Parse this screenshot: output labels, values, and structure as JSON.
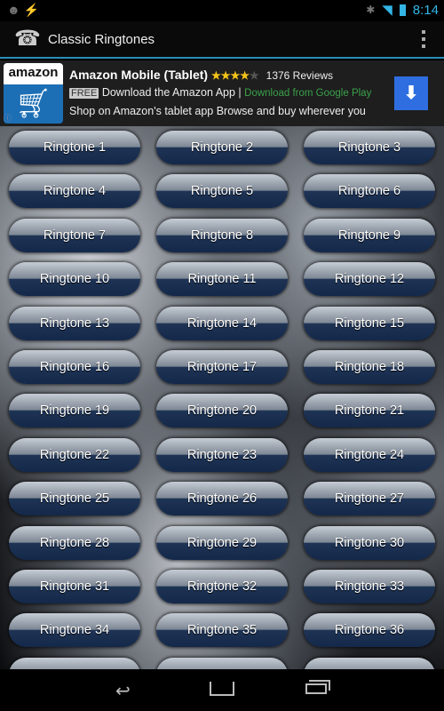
{
  "status_bar": {
    "time": "8:14",
    "icons": [
      "android-debug-icon",
      "usb-charge-icon",
      "bluetooth-icon",
      "wifi-icon",
      "battery-icon"
    ]
  },
  "action_bar": {
    "title": "Classic Ringtones",
    "icon": "vintage-telephone-icon",
    "menu": "overflow-menu-icon"
  },
  "ad": {
    "logo_text": "amazon",
    "title": "Amazon Mobile (Tablet)",
    "rating": 4,
    "rating_max": 5,
    "reviews": "1376 Reviews",
    "free_badge": "FREE",
    "line2": "Download the Amazon App |",
    "cta": "Download from Google Play",
    "line3": "Shop on Amazon's tablet app Browse and buy wherever you",
    "accent": "#2f6ee0"
  },
  "ringtones": [
    "Ringtone 1",
    "Ringtone 2",
    "Ringtone 3",
    "Ringtone 4",
    "Ringtone 5",
    "Ringtone 6",
    "Ringtone 7",
    "Ringtone 8",
    "Ringtone 9",
    "Ringtone 10",
    "Ringtone 11",
    "Ringtone 12",
    "Ringtone 13",
    "Ringtone 14",
    "Ringtone 15",
    "Ringtone 16",
    "Ringtone 17",
    "Ringtone 18",
    "Ringtone 19",
    "Ringtone 20",
    "Ringtone 21",
    "Ringtone 22",
    "Ringtone 23",
    "Ringtone 24",
    "Ringtone 25",
    "Ringtone 26",
    "Ringtone 27",
    "Ringtone 28",
    "Ringtone 29",
    "Ringtone 30",
    "Ringtone 31",
    "Ringtone 32",
    "Ringtone 33",
    "Ringtone 34",
    "Ringtone 35",
    "Ringtone 36"
  ],
  "nav_bar": {
    "icons": [
      "back-icon",
      "home-icon",
      "recent-apps-icon"
    ]
  }
}
